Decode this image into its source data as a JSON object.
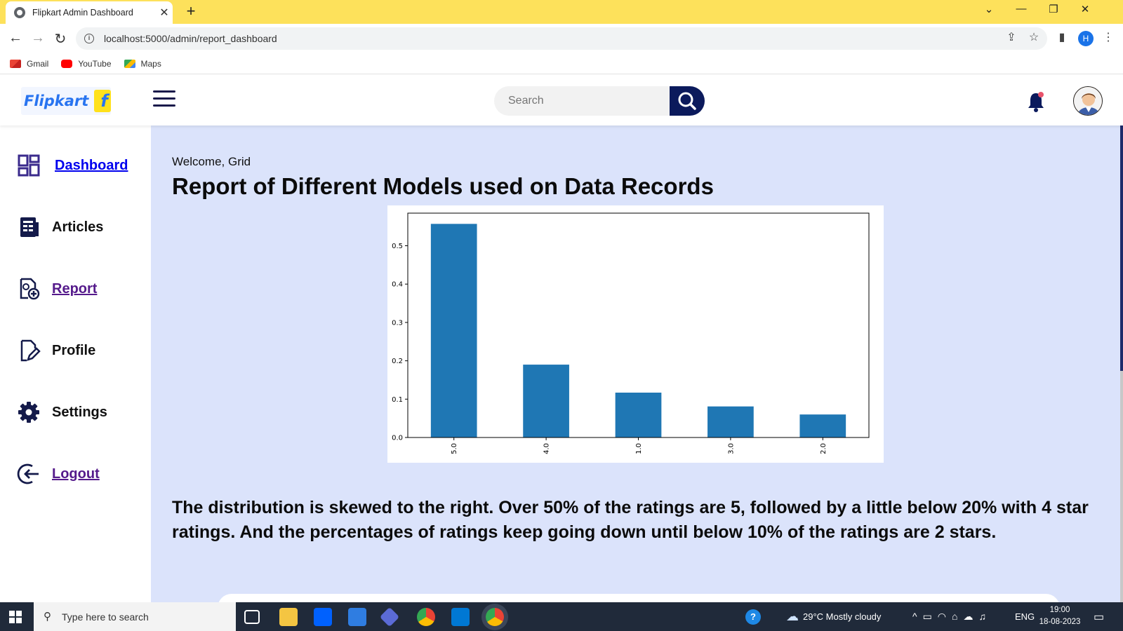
{
  "browser": {
    "tab_title": "Flipkart Admin Dashboard",
    "url": "localhost:5000/admin/report_dashboard",
    "profile_initial": "H",
    "bookmarks": [
      {
        "label": "Gmail",
        "icon": "gmail-icon",
        "color": "#ea4335"
      },
      {
        "label": "YouTube",
        "icon": "youtube-icon",
        "color": "#ff0000"
      },
      {
        "label": "Maps",
        "icon": "maps-icon",
        "color": "#34a853"
      }
    ]
  },
  "header": {
    "logo_text": "Flipkart",
    "search_placeholder": "Search"
  },
  "sidebar": {
    "items": [
      {
        "label": "Dashboard",
        "icon": "dashboard-grid-icon",
        "style": "link"
      },
      {
        "label": "Articles",
        "icon": "articles-icon",
        "style": "plain"
      },
      {
        "label": "Report",
        "icon": "report-icon",
        "style": "visited"
      },
      {
        "label": "Profile",
        "icon": "profile-edit-icon",
        "style": "plain"
      },
      {
        "label": "Settings",
        "icon": "gear-icon",
        "style": "plain"
      },
      {
        "label": "Logout",
        "icon": "logout-icon",
        "style": "visited"
      }
    ]
  },
  "main": {
    "welcome": "Welcome, Grid",
    "title": "Report of Different Models used on Data Records",
    "summary": "The distribution is skewed to the right. Over 50% of the ratings are 5, followed by a little below 20% with 4 star ratings. And the percentages of ratings keep going down until below 10% of the ratings are 2 stars."
  },
  "chart_data": {
    "type": "bar",
    "categories": [
      "5.0",
      "4.0",
      "1.0",
      "3.0",
      "2.0"
    ],
    "values": [
      0.557,
      0.19,
      0.117,
      0.081,
      0.06
    ],
    "yticks": [
      "0.0",
      "0.1",
      "0.2",
      "0.3",
      "0.4",
      "0.5"
    ],
    "ylim": [
      0,
      0.585
    ],
    "bar_color": "#1f77b4",
    "grid": false,
    "xlabel": "",
    "ylabel": "",
    "title": ""
  },
  "taskbar": {
    "search_placeholder": "Type here to search",
    "weather": "29°C  Mostly cloudy",
    "language": "ENG",
    "time": "19:00",
    "date": "18-08-2023"
  },
  "colors": {
    "accent_navy": "#0b1a5c",
    "main_bg": "#dbe3fb",
    "tab_bar": "#fde15b"
  }
}
